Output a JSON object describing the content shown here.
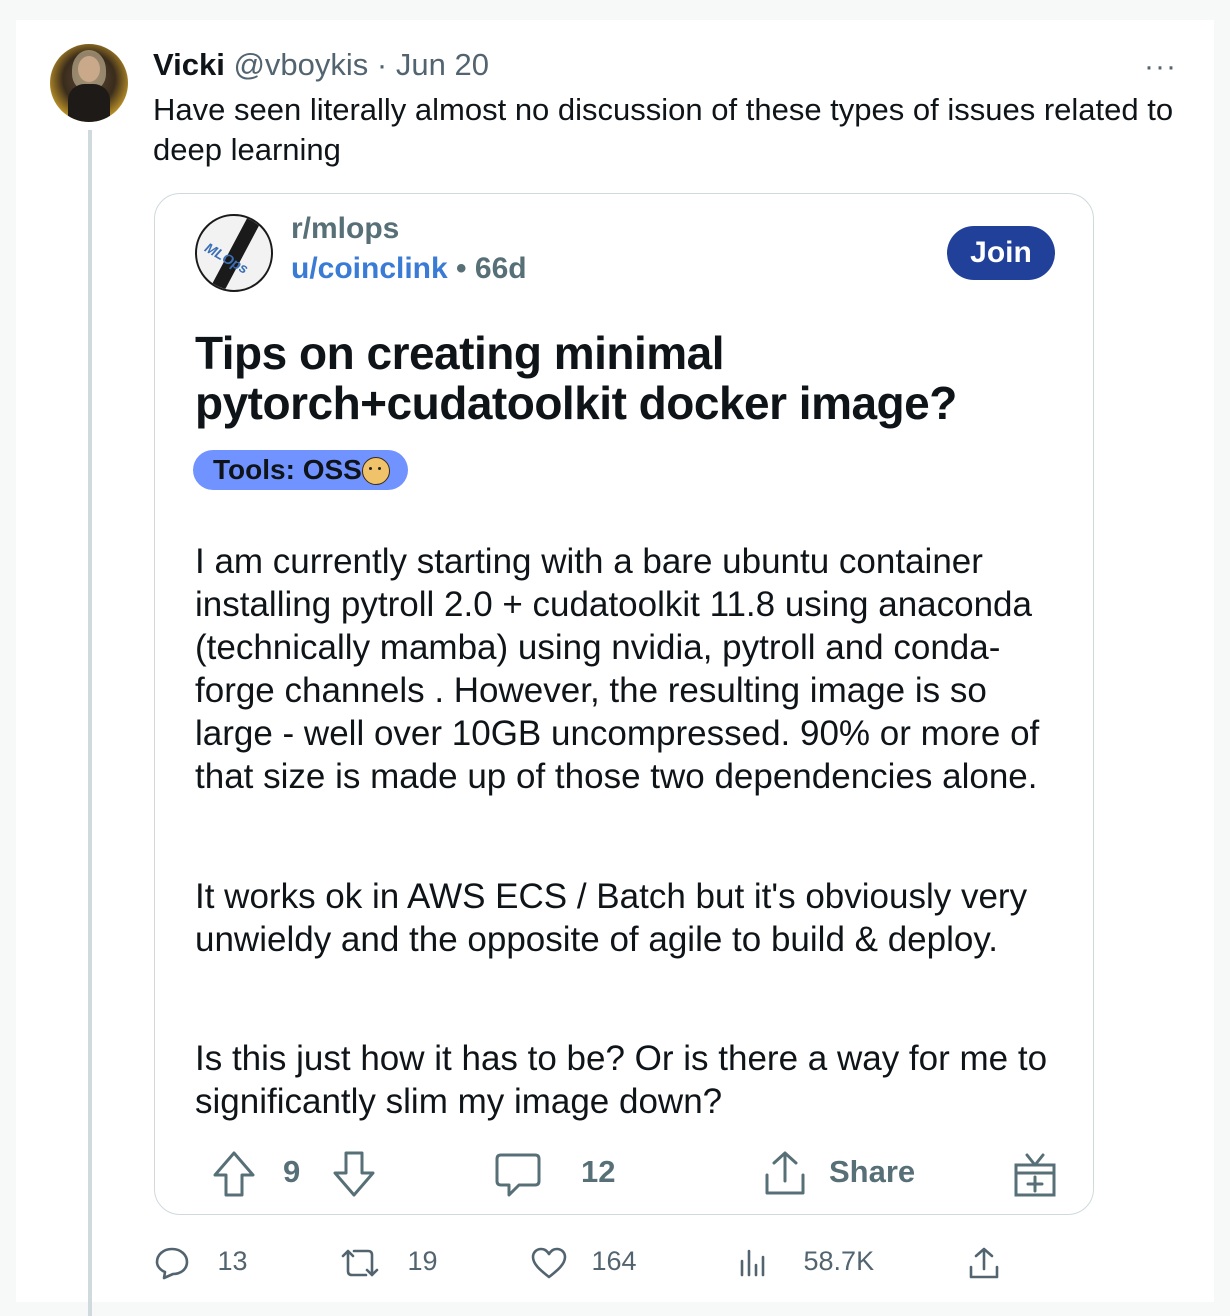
{
  "tweet": {
    "author_name": "Vicki",
    "author_handle": "@vboykis",
    "separator": "·",
    "date": "Jun 20",
    "more_label": "···",
    "text": "Have seen literally almost no discussion of these types of issues related to deep learning"
  },
  "reddit_post": {
    "subreddit": "r/mlops",
    "user": "u/coinclink",
    "dot": "•",
    "age": "66d",
    "join_label": "Join",
    "avatar_label": "MLOps",
    "title": "Tips on creating minimal pytorch+cudatoolkit docker image?",
    "flair": "Tools: OSS",
    "paragraphs": [
      "I am currently starting with a bare ubuntu container installing pytroll 2.0 + cudatoolkit 11.8 using anaconda (technically mamba) using nvidia, pytroll and conda-forge channels . However, the resulting image is so large - well over 10GB uncompressed. 90% or more of that size is made up of those two dependencies alone.",
      "It works ok in AWS ECS / Batch but it's obviously very unwieldy and the opposite of agile to build & deploy.",
      "Is this just how it has to be? Or is there a way for me to significantly slim my image down?"
    ],
    "votes": "9",
    "comments": "12",
    "share_label": "Share"
  },
  "tweet_actions": {
    "replies": "13",
    "retweets": "19",
    "likes": "164",
    "views": "58.7K"
  },
  "colors": {
    "join_bg": "#21409a",
    "flair_bg": "#7193ff",
    "user_link": "#3a7bd5",
    "muted": "#536471"
  }
}
